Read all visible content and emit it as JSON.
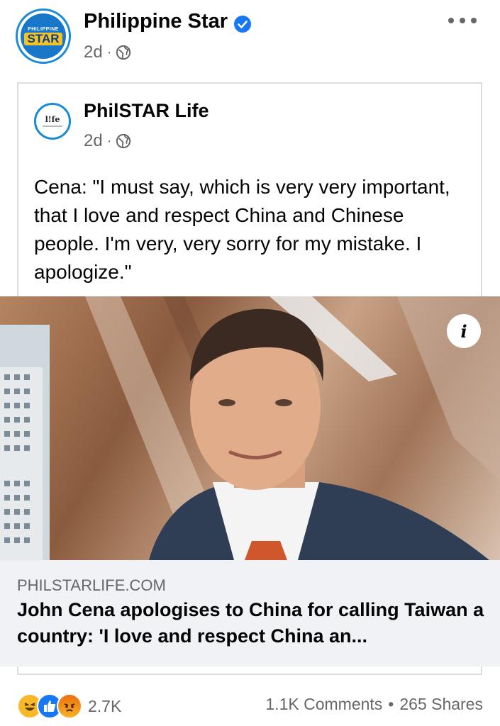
{
  "post": {
    "page_name": "Philippine Star",
    "time": "2d",
    "avatar_text_small": "PHILIPPINE",
    "avatar_text_big": "STAR"
  },
  "shared": {
    "page_name": "PhilSTAR Life",
    "time": "2d",
    "avatar_text": "l!fe",
    "text": "Cena: \"I must say, which is very very important, that I love and respect China and Chinese people. I'm very, very sorry for my mistake. I apologize.\""
  },
  "link": {
    "domain": "PHILSTARLIFE.COM",
    "title": "John Cena apologises to China for calling Taiwan a country: 'I love and respect China an..."
  },
  "engagement": {
    "reactions_count": "2.7K",
    "comments": "1.1K Comments",
    "separator": "•",
    "shares": "265 Shares"
  },
  "icons": [
    "verified-icon",
    "globe-icon",
    "more-icon",
    "info-icon",
    "haha-reaction-icon",
    "like-reaction-icon",
    "angry-reaction-icon"
  ],
  "colors": {
    "accent": "#1877f2",
    "meta_text": "#65676b",
    "link_bg": "#f0f2f5"
  }
}
